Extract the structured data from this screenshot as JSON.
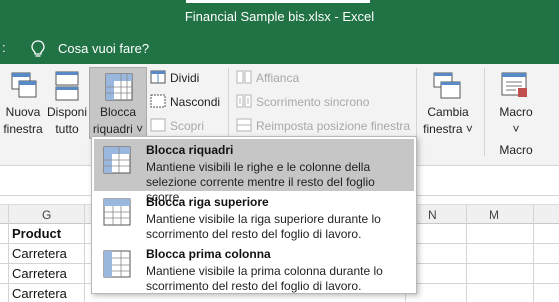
{
  "window": {
    "title": "Financial Sample bis.xlsx  -  Excel"
  },
  "tellme": {
    "prefix": ":",
    "placeholder": "Cosa vuoi fare?"
  },
  "ribbon": {
    "nuova_finestra": [
      "Nuova",
      "finestra"
    ],
    "disponi_tutto": [
      "Disponi",
      "tutto"
    ],
    "blocca_riquadri": [
      "Blocca",
      "riquadri ˅"
    ],
    "dividi": "Dividi",
    "nascondi": "Nascondi",
    "scopri": "Scopri",
    "affianca": "Affianca",
    "scorrimento_sincrono": "Scorrimento sincrono",
    "reimposta_posizione": "Reimposta posizione finestra",
    "cambia_finestra": [
      "Cambia",
      "finestra ˅"
    ],
    "macro": [
      "Macro",
      "˅"
    ],
    "macro_group": "Macro"
  },
  "sheet": {
    "columns": [
      "G",
      "N",
      "M"
    ],
    "header_cell": "Product",
    "rows": [
      "Carretera",
      "Carretera",
      "Carretera"
    ]
  },
  "dropdown": {
    "items": [
      {
        "title": "Blocca riquadri",
        "description": "Mantiene visibili le righe e le colonne della selezione corrente mentre il resto del foglio scorre."
      },
      {
        "title": "Blocca riga superiore",
        "description": "Mantiene visibile la riga superiore durante lo scorrimento del resto del foglio di lavoro."
      },
      {
        "title": "Blocca prima colonna",
        "description": "Mantiene visibile la prima colonna durante lo scorrimento del resto del foglio di lavoro."
      }
    ]
  },
  "colors": {
    "titlebar": "#217346",
    "highlight": "#c6c6c6",
    "ribbon_bg": "#f3f3f3"
  }
}
